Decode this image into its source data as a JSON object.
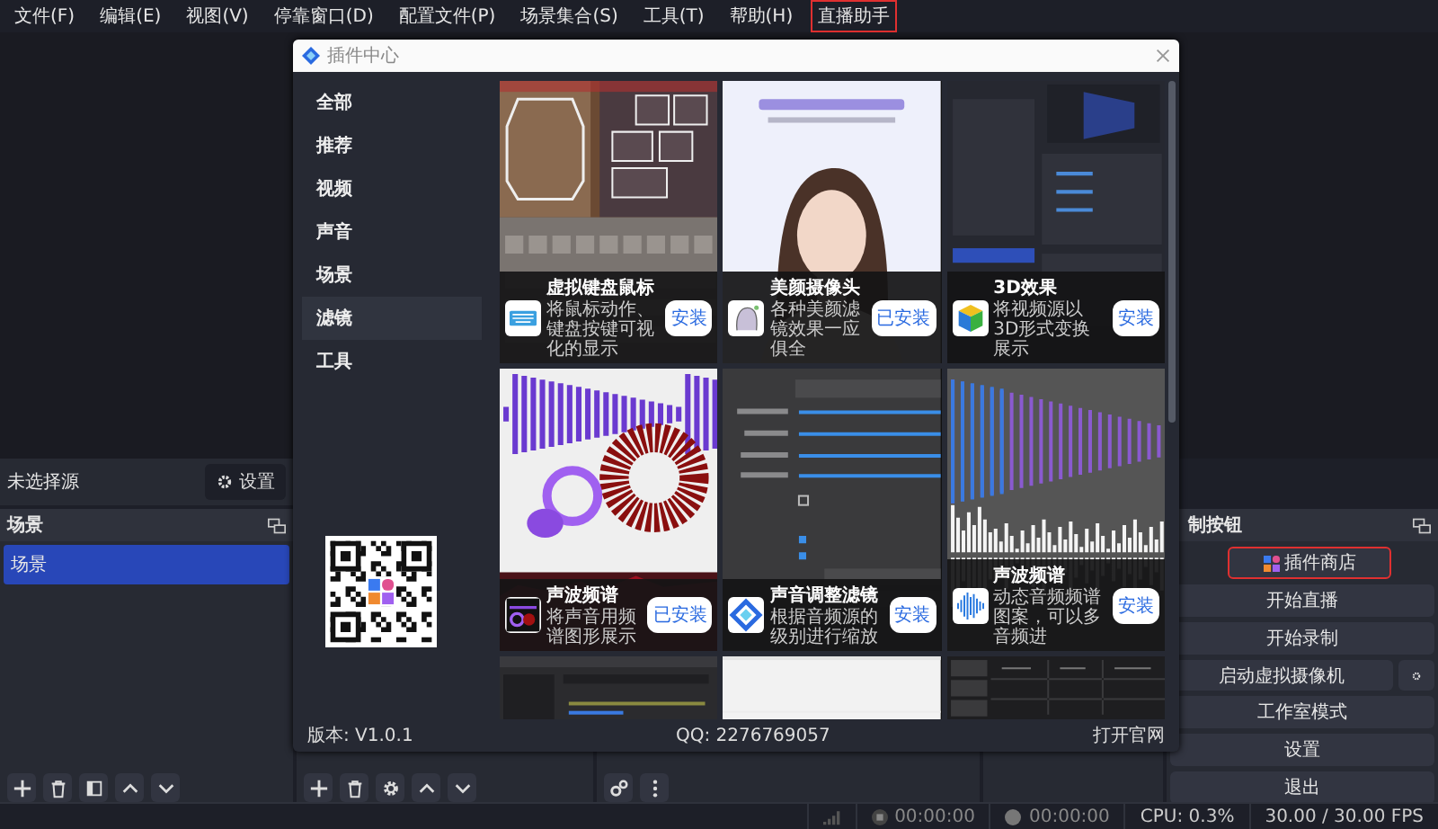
{
  "menu": [
    {
      "label": "文件(F)",
      "highlighted": false
    },
    {
      "label": "编辑(E)",
      "highlighted": false
    },
    {
      "label": "视图(V)",
      "highlighted": false
    },
    {
      "label": "停靠窗口(D)",
      "highlighted": false
    },
    {
      "label": "配置文件(P)",
      "highlighted": false
    },
    {
      "label": "场景集合(S)",
      "highlighted": false
    },
    {
      "label": "工具(T)",
      "highlighted": false
    },
    {
      "label": "帮助(H)",
      "highlighted": false
    },
    {
      "label": "直播助手",
      "highlighted": true
    }
  ],
  "source_bar": {
    "label": "未选择源",
    "settings_button": "设置"
  },
  "scenes": {
    "title": "场景",
    "items": [
      {
        "name": "场景",
        "selected": true
      }
    ]
  },
  "controls": {
    "title": "制按钮",
    "buttons": [
      {
        "label": "插件商店",
        "kind": "store",
        "highlighted": true
      },
      {
        "label": "开始直播",
        "kind": "plain",
        "highlighted": false
      },
      {
        "label": "开始录制",
        "kind": "plain",
        "highlighted": false
      },
      {
        "label": "启动虚拟摄像机",
        "kind": "camera",
        "highlighted": false
      },
      {
        "label": "工作室模式",
        "kind": "plain",
        "highlighted": false
      },
      {
        "label": "设置",
        "kind": "plain",
        "highlighted": false
      },
      {
        "label": "退出",
        "kind": "plain",
        "highlighted": false
      }
    ]
  },
  "status_bar": {
    "stream_time": "00:00:00",
    "record_time": "00:00:00",
    "cpu": "CPU: 0.3%",
    "fps": "30.00 / 30.00 FPS"
  },
  "dialog": {
    "title": "插件中心",
    "categories": [
      {
        "label": "全部",
        "selected": false
      },
      {
        "label": "推荐",
        "selected": false
      },
      {
        "label": "视频",
        "selected": false
      },
      {
        "label": "声音",
        "selected": false
      },
      {
        "label": "场景",
        "selected": false
      },
      {
        "label": "滤镜",
        "selected": true
      },
      {
        "label": "工具",
        "selected": false
      }
    ],
    "plugins": [
      {
        "kind": "card",
        "title": "虚拟键盘鼠标",
        "description": "将鼠标动作、键盘按键可视化的显示",
        "action": "安装"
      },
      {
        "kind": "card",
        "title": "美颜摄像头",
        "description": "各种美颜滤镜效果一应俱全",
        "action": "已安装"
      },
      {
        "kind": "card",
        "title": "3D效果",
        "description": "将视频源以3D形式变换展示",
        "action": "安装"
      },
      {
        "kind": "card",
        "title": "声波频谱",
        "description": "将声音用频谱图形展示",
        "action": "已安装"
      },
      {
        "kind": "card",
        "title": "声音调整滤镜",
        "description": "根据音频源的级别进行缩放",
        "action": "安装"
      },
      {
        "kind": "card",
        "title": "声波频谱",
        "description": "动态音频频谱图案，可以多音频进",
        "action": "安装"
      },
      {
        "kind": "preview"
      },
      {
        "kind": "preview"
      },
      {
        "kind": "preview"
      }
    ],
    "version": "版本: V1.0.1",
    "qq": "QQ: 2276769057",
    "website_link": "打开官网"
  }
}
